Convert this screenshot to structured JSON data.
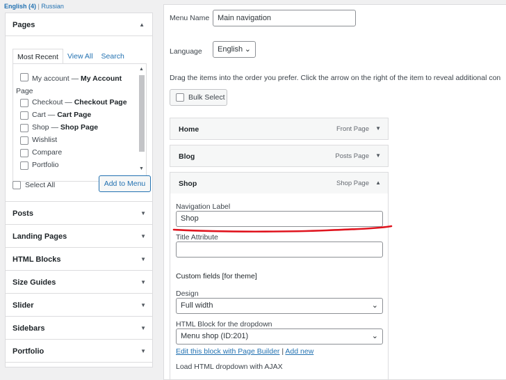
{
  "languages": {
    "current": "English (4)",
    "separator": "|",
    "other": "Russian"
  },
  "left_panel": {
    "pages_title": "Pages",
    "tabs": [
      "Most Recent",
      "View All",
      "Search"
    ],
    "pages": [
      {
        "title": "My account",
        "sep": " — ",
        "type": "My Account Page",
        "type_first": "My Account",
        "type_rest": "Page"
      },
      {
        "title": "Checkout",
        "sep": " — ",
        "type": "Checkout Page"
      },
      {
        "title": "Cart",
        "sep": " — ",
        "type": "Cart Page"
      },
      {
        "title": "Shop",
        "sep": " — ",
        "type": "Shop Page"
      },
      {
        "title": "Wishlist"
      },
      {
        "title": "Compare"
      },
      {
        "title": "Portfolio"
      }
    ],
    "select_all": "Select All",
    "add_to_menu": "Add to Menu",
    "sections": [
      "Posts",
      "Landing Pages",
      "HTML Blocks",
      "Size Guides",
      "Slider",
      "Sidebars",
      "Portfolio"
    ]
  },
  "menu": {
    "name_label": "Menu Name",
    "name_value": "Main navigation",
    "language_label": "Language",
    "language_value": "English",
    "instructions": "Drag the items into the order you prefer. Click the arrow on the right of the item to reveal additional con",
    "bulk_select": "Bulk Select",
    "items": [
      {
        "name": "Home",
        "type": "Front Page"
      },
      {
        "name": "Blog",
        "type": "Posts Page"
      },
      {
        "name": "Shop",
        "type": "Shop Page"
      }
    ],
    "shop_settings": {
      "nav_label_label": "Navigation Label",
      "nav_label_value": "Shop",
      "title_attr_label": "Title Attribute",
      "title_attr_value": "",
      "custom_fields_heading": "Custom fields [for theme]",
      "design_label": "Design",
      "design_value": "Full width",
      "html_block_label": "HTML Block for the dropdown",
      "html_block_value": "Menu shop (ID:201)",
      "edit_link": "Edit this block with Page Builder",
      "link_sep": "|",
      "add_new_link": "Add new",
      "cutoff_label": "Load HTML dropdown with AJAX"
    }
  },
  "colors": {
    "link": "#2271b1",
    "annotation": "#e0141e"
  },
  "icons": {
    "collapse": "triangle-up",
    "expand": "triangle-down",
    "select": "chevron-down"
  }
}
